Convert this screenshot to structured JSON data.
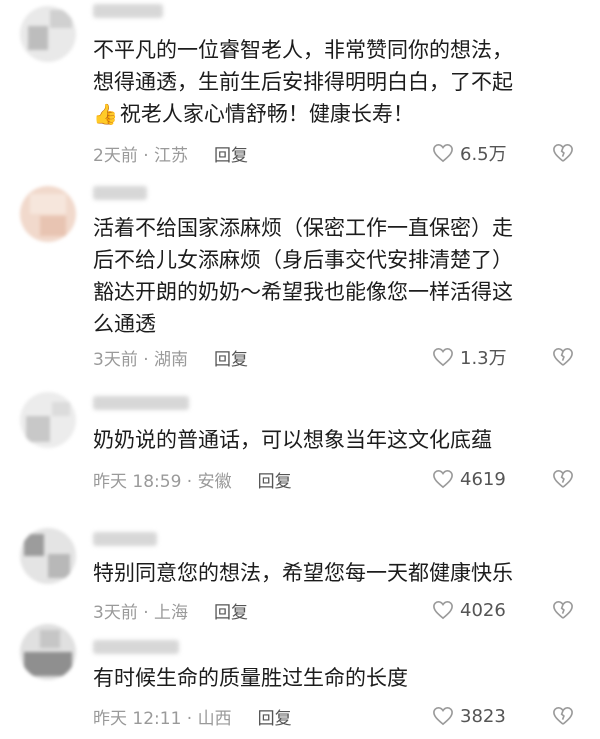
{
  "comments": [
    {
      "text": "不平凡的一位睿智老人，非常赞同你的想法，\n想得通透，生前生后安排得明明白白，了不起\n",
      "text_tail": "祝老人家心情舒畅！健康长寿！",
      "emoji": "👍",
      "time_location": "2天前 · 江苏",
      "reply_label": "回复",
      "likes": "6.5万"
    },
    {
      "text": "活着不给国家添麻烦（保密工作一直保密）走\n后不给儿女添麻烦（身后事交代安排清楚了）\n豁达开朗的奶奶～希望我也能像您一样活得这\n么通透",
      "time_location": "3天前 · 湖南",
      "reply_label": "回复",
      "likes": "1.3万"
    },
    {
      "text": "奶奶说的普通话，可以想象当年这文化底蕴",
      "time_location": "昨天 18:59 · 安徽",
      "reply_label": "回复",
      "likes": "4619"
    },
    {
      "text": "特别同意您的想法，希望您每一天都健康快乐",
      "time_location": "3天前 · 上海",
      "reply_label": "回复",
      "likes": "4026"
    },
    {
      "text": "有时候生命的质量胜过生命的长度",
      "time_location": "昨天 12:11 · 山西",
      "reply_label": "回复",
      "likes": "3823"
    }
  ],
  "icons": {
    "like": "heart-outline-icon",
    "dislike": "broken-heart-icon"
  },
  "colors": {
    "text": "#1c1c1c",
    "meta": "#9a9a9a",
    "icon": "#9a9a9a"
  }
}
